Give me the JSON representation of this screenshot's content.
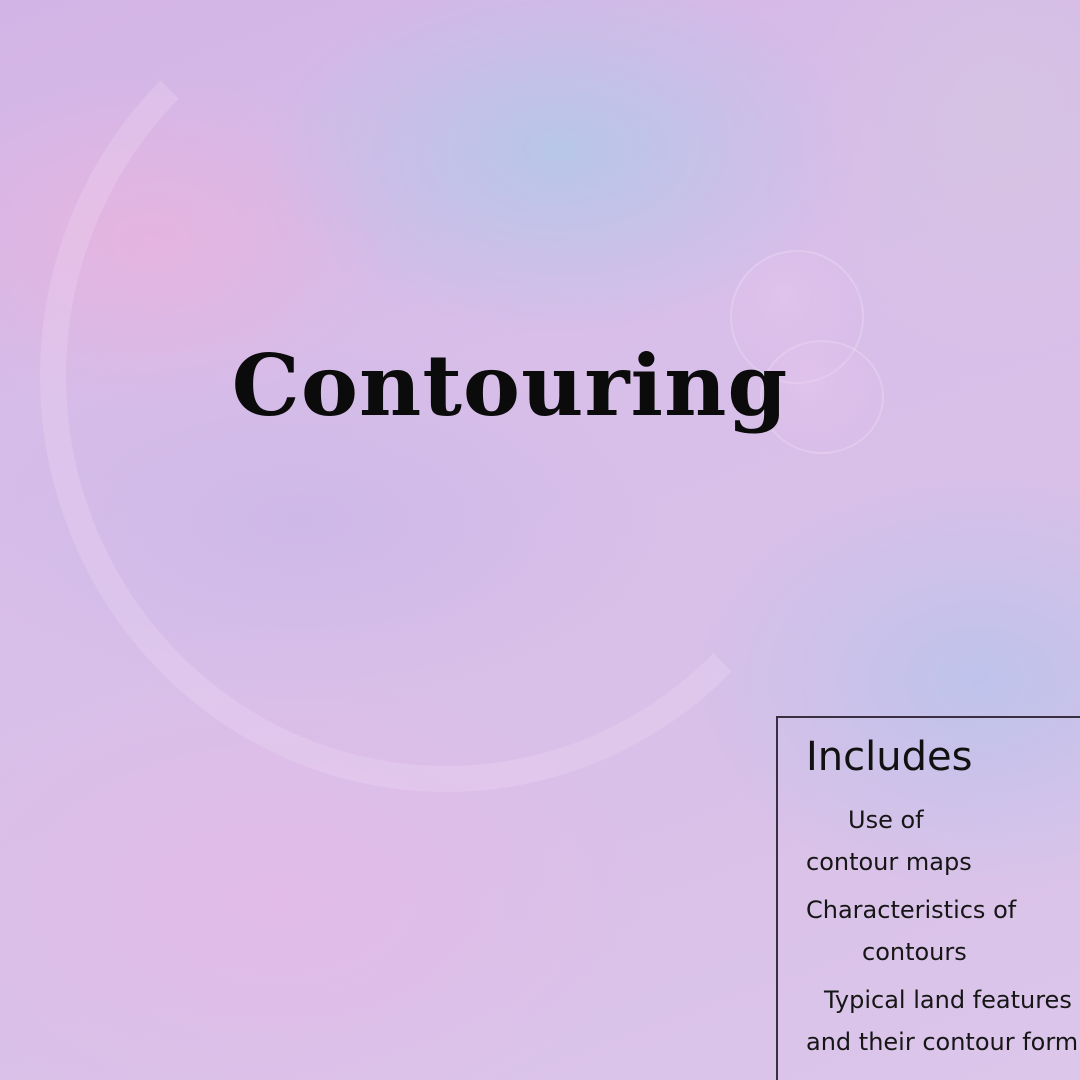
{
  "title": "Contouring",
  "panel": {
    "heading": "Includes",
    "lines": [
      "Use of",
      "contour maps",
      "Characteristics of",
      "contours",
      "Typical land features",
      "and their contour form"
    ]
  },
  "colors": {
    "background": "#dcc3e8",
    "text": "#0b0b0b",
    "panel_border": "#3a2f40"
  }
}
